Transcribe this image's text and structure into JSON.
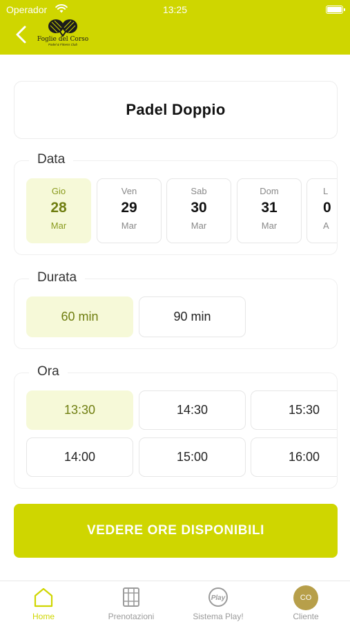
{
  "status_bar": {
    "carrier": "Operador",
    "time": "13:25"
  },
  "header": {
    "logo_name": "Foglie del Corso",
    "logo_tagline": "Padel & Fitness Club"
  },
  "title": "Padel Doppio",
  "date_section": {
    "legend": "Data",
    "dates": [
      {
        "dow": "Gio",
        "day": "28",
        "month": "Mar",
        "selected": true
      },
      {
        "dow": "Ven",
        "day": "29",
        "month": "Mar",
        "selected": false
      },
      {
        "dow": "Sab",
        "day": "30",
        "month": "Mar",
        "selected": false
      },
      {
        "dow": "Dom",
        "day": "31",
        "month": "Mar",
        "selected": false
      },
      {
        "dow": "L",
        "day": "0",
        "month": "A",
        "selected": false
      }
    ]
  },
  "duration_section": {
    "legend": "Durata",
    "options": [
      "60 min",
      "90 min"
    ],
    "selected": "60 min"
  },
  "time_section": {
    "legend": "Ora",
    "slots": [
      "13:30",
      "14:30",
      "15:30",
      "14:00",
      "15:00",
      "16:00"
    ],
    "selected": "13:30"
  },
  "cta": {
    "label": "VEDERE ORE DISPONIBILI"
  },
  "tabbar": {
    "items": [
      {
        "label": "Home",
        "icon": "home-icon",
        "active": true
      },
      {
        "label": "Prenotazioni",
        "icon": "calendar-icon",
        "active": false
      },
      {
        "label": "Sistema Play!",
        "icon": "play-logo-icon",
        "active": false
      },
      {
        "label": "Cliente",
        "icon": "avatar",
        "active": false
      }
    ],
    "avatar_initials": "CO"
  },
  "colors": {
    "accent": "#cfd600",
    "selected_bg": "#f6f9d8",
    "selected_text": "#6f7e10",
    "avatar": "#b79f4a"
  }
}
